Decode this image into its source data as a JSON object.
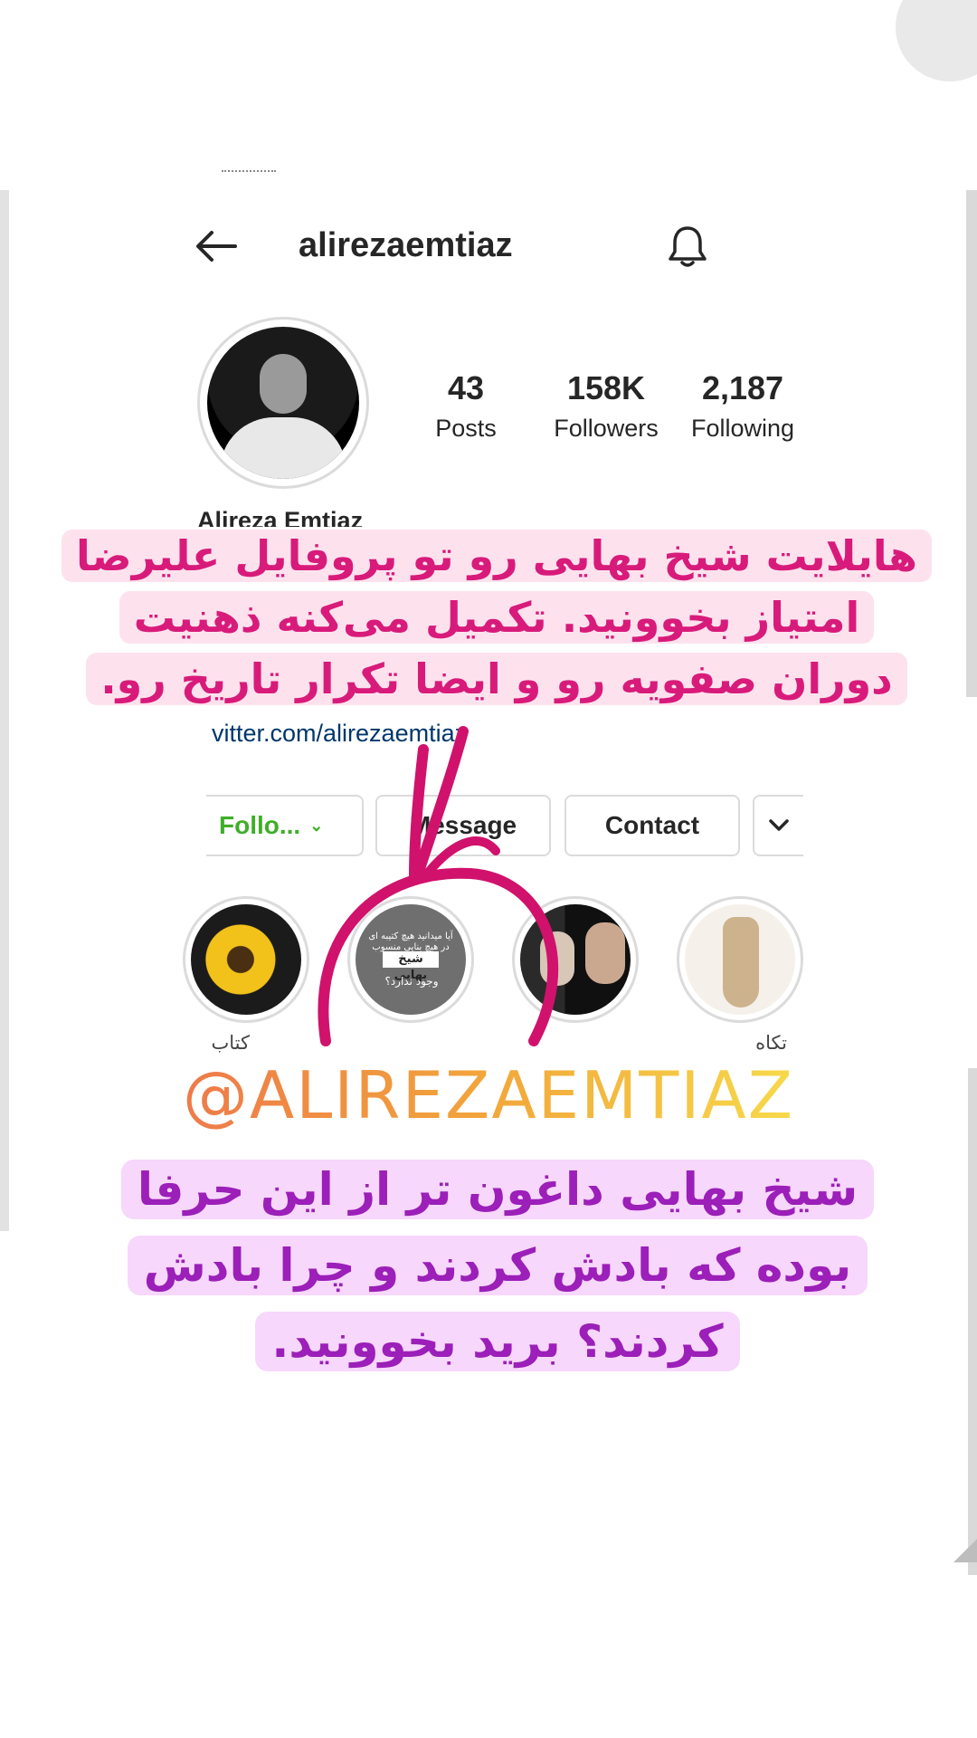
{
  "profile": {
    "username": "alirezaemtiaz",
    "full_name": "Alireza Emtiaz",
    "link_text": "vitter.com/alirezaemtiaz",
    "stats": {
      "posts_count": "43",
      "posts_label": "Posts",
      "followers_count": "158K",
      "followers_label": "Followers",
      "following_count": "2,187",
      "following_label": "Following"
    }
  },
  "buttons": {
    "follow": "Follo...",
    "message": "Message",
    "contact": "Contact"
  },
  "highlights": [
    {
      "label": "کتاب",
      "icon": "sunflower-watch"
    },
    {
      "label": "",
      "icon": "sheikh-bahaei-cover",
      "text_top": "آیا میدانید هیچ کتیبه ای در هیچ بنایی منسوب به",
      "text_tag": "شیخ بهایی",
      "text_bottom": "وجود ندارد؟"
    },
    {
      "label": "",
      "icon": "two-men-photo"
    },
    {
      "label": "تکاه",
      "icon": "figurine"
    }
  ],
  "overlays": {
    "top_text": "هایلایت شیخ بهایی رو تو پروفایل علیرضا امتیاز بخوونید. تکمیل می‌کنه ذهنیت دوران صفویه رو و ایضا تکرار تاریخ رو.",
    "mention": "@ALIREZAEMTIAZ",
    "bottom_text": "شیخ بهایی داغون تر از این حرفا بوده که بادش کردند و چرا بادش کردند؟ برید بخوونید."
  },
  "colors": {
    "follow_green": "#3fae29",
    "overlay1_text": "#d81b7a",
    "overlay1_bg": "#fde2ee",
    "overlay2_text": "#9b1fb8",
    "overlay2_bg": "#f7d7fb",
    "doodle_pink": "#d0126c"
  }
}
